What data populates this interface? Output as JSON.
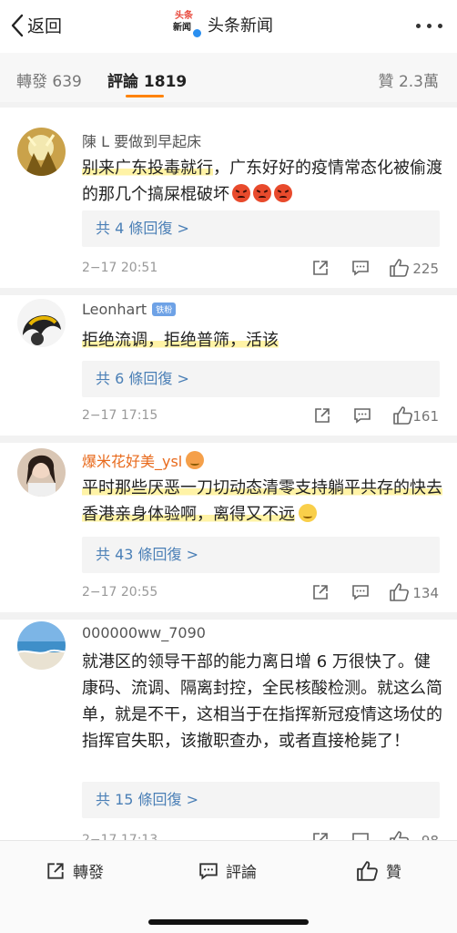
{
  "header": {
    "back_label": "返回",
    "logo_top": "头条",
    "logo_bottom": "新闻",
    "title": "头条新闻",
    "icons": [
      "chevron-left-icon",
      "more-icon"
    ]
  },
  "tabs": {
    "repost": "轉發 639",
    "comment": "評論 1819",
    "like": "贊 2.3萬",
    "accent": "#ff8200"
  },
  "comments": [
    {
      "user": "陳 L 要做到早起床",
      "text_hl": "别来广东投毒就行",
      "text_rest": "，广东好好的疫情常态化被偷渡的那几个搞屎棍破坏",
      "replies": "共 4 條回復 >",
      "time": "2−17 20:51",
      "likes": "225"
    },
    {
      "user": "Leonhart",
      "badge": "铁粉",
      "text_hl": "拒绝流调，拒绝普筛，活该",
      "text_rest": "",
      "replies": "共 6 條回復 >",
      "time": "2−17 17:15",
      "likes": "161"
    },
    {
      "user": "爆米花好美_ysl",
      "text_hl": "平时那些厌恶一刀切动态清零支持躺平共存的快去香港亲身体验啊，离得又不远",
      "text_rest": "",
      "replies": "共 43 條回復 >",
      "time": "2−17 20:55",
      "likes": "134"
    },
    {
      "user": "000000ww_7090",
      "text_hl": "",
      "text_rest": "就港区的领导干部的能力离日增 6 万很快了。健康码、流调、隔离封控，全民核酸检测。就这么简单，就是不干，这相当于在指挥新冠疫情这场仗的指挥官失职，该撤职查办，或者直接枪毙了！",
      "replies": "共 15 條回復 >",
      "time": "2−17 17:13",
      "likes": "98"
    }
  ],
  "bottom_bar": {
    "repost": "轉發",
    "comment": "評論",
    "like": "贊"
  }
}
